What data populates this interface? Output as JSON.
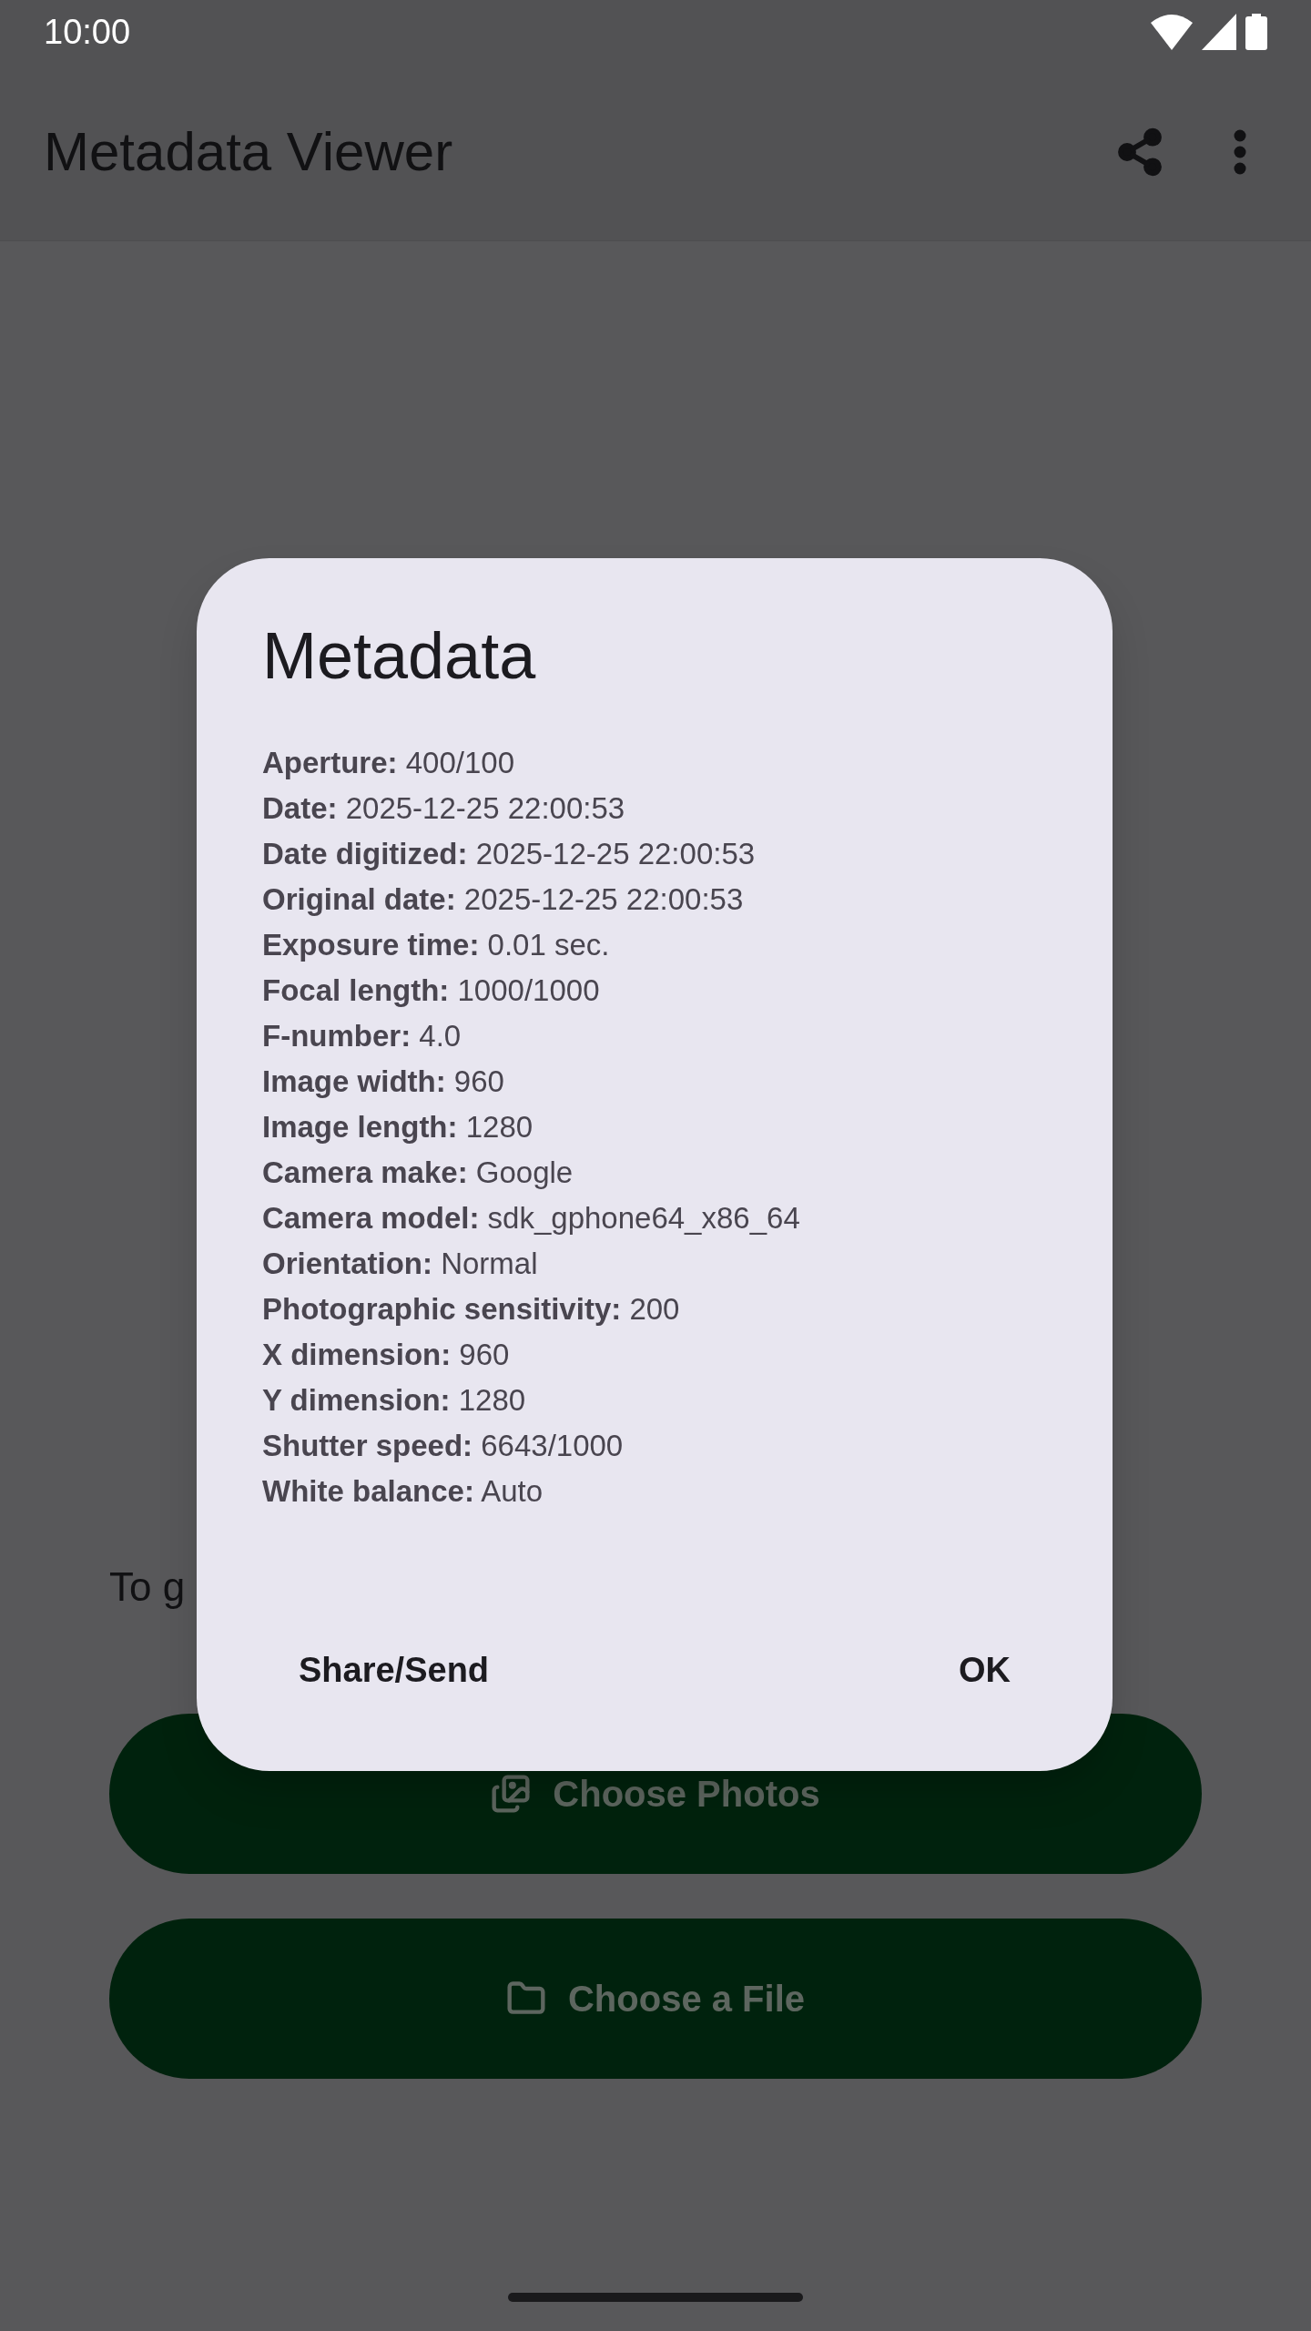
{
  "status_bar": {
    "time": "10:00"
  },
  "app_bar": {
    "title": "Metadata Viewer"
  },
  "main": {
    "intro_text": "To g",
    "buttons": [
      {
        "label": "Choose Photos",
        "kind": "photos"
      },
      {
        "label": "Choose a File",
        "kind": "file"
      }
    ]
  },
  "dialog": {
    "title": "Metadata",
    "lines": [
      "**Aperture:** 400/100",
      "**Date:** 2025-12-25 22:00:53",
      "**Date digitized:** 2025-12-25 22:00:53",
      "**Original date:** 2025-12-25 22:00:53",
      "**Exposure time:** 0.01 sec.",
      "**Focal length:** 1000/1000",
      "**F-number:** 4.0",
      "**Image width:** 960",
      "**Image length:** 1280",
      "**Camera make:** Google",
      "**Camera model:** sdk_gphone64_x86_64",
      "**Orientation:** Normal",
      "**Photographic sensitivity:** 200",
      "**X dimension:** 960",
      "**Y dimension:** 1280",
      "**Shutter speed:** 6643/1000",
      "**White balance:** Auto"
    ],
    "actions": [
      "Share/Send",
      "OK"
    ]
  }
}
